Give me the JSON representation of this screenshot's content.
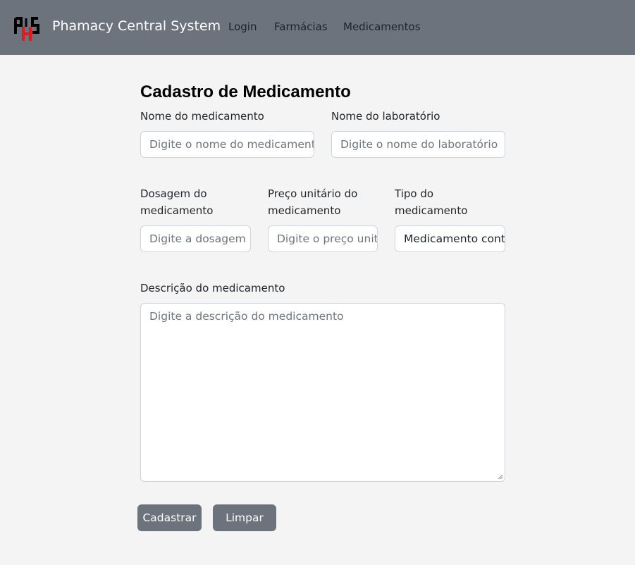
{
  "navbar": {
    "logo_text": "PHS",
    "brand": "Phamacy Central System",
    "links": [
      "Login",
      "Farmácias",
      "Medicamentos"
    ]
  },
  "form": {
    "title": "Cadastro de Medicamento",
    "nome": {
      "label": "Nome do medicamento",
      "placeholder": "Digite o nome do medicamento"
    },
    "laboratorio": {
      "label": "Nome do laboratório",
      "placeholder": "Digite o nome do laboratório"
    },
    "dosagem": {
      "label": "Dosagem do medicamento",
      "placeholder": "Digite a dosagem"
    },
    "preco": {
      "label": "Preço unitário do medicamento",
      "placeholder": "Digite o preço unitário"
    },
    "tipo": {
      "label": "Tipo do medicamento",
      "value": "Medicamento controlado"
    },
    "descricao": {
      "label": "Descrição do medicamento",
      "placeholder": "Digite a descrição do medicamento"
    },
    "buttons": {
      "submit": "Cadastrar",
      "clear": "Limpar"
    }
  },
  "colors": {
    "navbar_bg": "#6c737d",
    "page_bg": "#f4f4f4",
    "logo_red": "#e01b1b"
  }
}
